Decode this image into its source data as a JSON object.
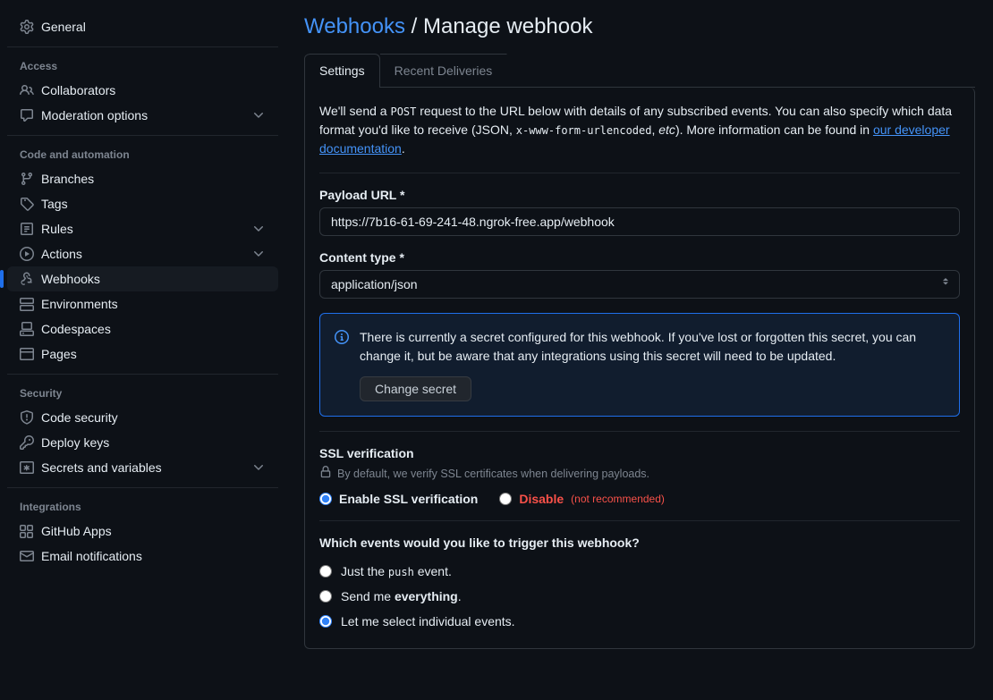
{
  "sidebar": {
    "top": [
      {
        "icon": "gear",
        "label": "General"
      }
    ],
    "groups": [
      {
        "heading": "Access",
        "items": [
          {
            "icon": "people",
            "label": "Collaborators"
          },
          {
            "icon": "comment",
            "label": "Moderation options",
            "expandable": true
          }
        ]
      },
      {
        "heading": "Code and automation",
        "items": [
          {
            "icon": "branch",
            "label": "Branches"
          },
          {
            "icon": "tag",
            "label": "Tags"
          },
          {
            "icon": "rules",
            "label": "Rules",
            "expandable": true
          },
          {
            "icon": "play",
            "label": "Actions",
            "expandable": true
          },
          {
            "icon": "webhook",
            "label": "Webhooks",
            "active": true
          },
          {
            "icon": "env",
            "label": "Environments"
          },
          {
            "icon": "codespaces",
            "label": "Codespaces"
          },
          {
            "icon": "pages",
            "label": "Pages"
          }
        ]
      },
      {
        "heading": "Security",
        "items": [
          {
            "icon": "shield",
            "label": "Code security"
          },
          {
            "icon": "key",
            "label": "Deploy keys"
          },
          {
            "icon": "secrets",
            "label": "Secrets and variables",
            "expandable": true
          }
        ]
      },
      {
        "heading": "Integrations",
        "items": [
          {
            "icon": "apps",
            "label": "GitHub Apps"
          },
          {
            "icon": "mail",
            "label": "Email notifications"
          }
        ]
      }
    ]
  },
  "breadcrumb": {
    "root": "Webhooks",
    "sep": "/",
    "current": "Manage webhook"
  },
  "tabs": [
    {
      "label": "Settings",
      "active": true
    },
    {
      "label": "Recent Deliveries"
    }
  ],
  "intro": {
    "pre": "We'll send a ",
    "code1": "POST",
    "mid1": " request to the URL below with details of any subscribed events. You can also specify which data format you'd like to receive (JSON, ",
    "code2": "x-www-form-urlencoded",
    "mid2": ", ",
    "etc": "etc",
    "mid3": "). More information can be found in ",
    "link": "our developer documentation",
    "post": "."
  },
  "form": {
    "payload_url_label": "Payload URL *",
    "payload_url_value": "https://7b16-61-69-241-48.ngrok-free.app/webhook",
    "content_type_label": "Content type *",
    "content_type_value": "application/json"
  },
  "secret_box": {
    "text": "There is currently a secret configured for this webhook. If you've lost or forgotten this secret, you can change it, but be aware that any integrations using this secret will need to be updated.",
    "button": "Change secret"
  },
  "ssl": {
    "title": "SSL verification",
    "hint": "By default, we verify SSL certificates when delivering payloads.",
    "enable": "Enable SSL verification",
    "disable": "Disable",
    "disable_note": "(not recommended)"
  },
  "events": {
    "title": "Which events would you like to trigger this webhook?",
    "opt1_pre": "Just the ",
    "opt1_code": "push",
    "opt1_post": " event.",
    "opt2_pre": "Send me ",
    "opt2_strong": "everything",
    "opt2_post": ".",
    "opt3": "Let me select individual events."
  }
}
